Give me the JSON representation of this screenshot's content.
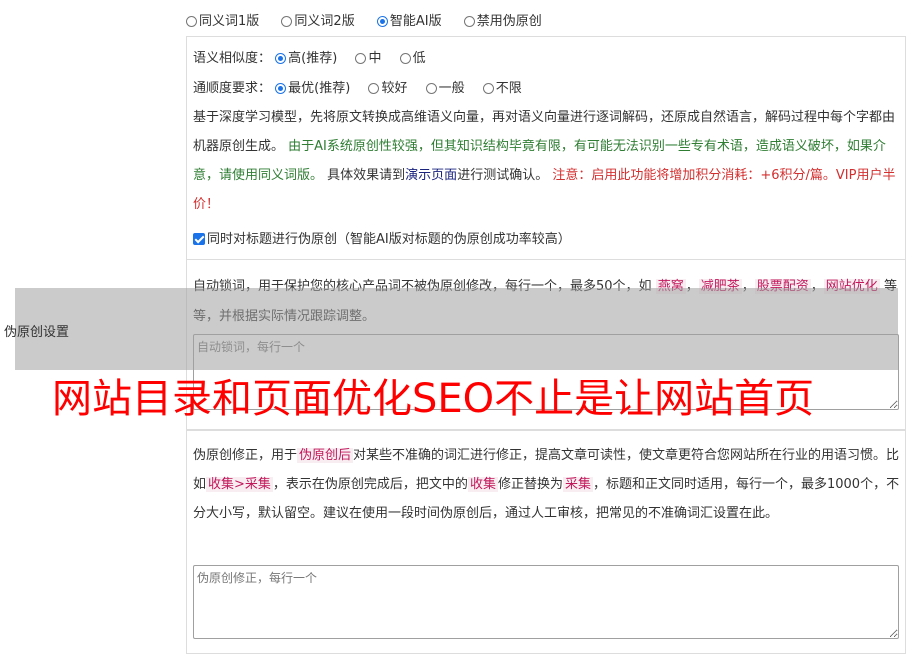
{
  "modes": [
    {
      "label": "同义词1版",
      "selected": false
    },
    {
      "label": "同义词2版",
      "selected": false
    },
    {
      "label": "智能AI版",
      "selected": true
    },
    {
      "label": "禁用伪原创",
      "selected": false
    }
  ],
  "similarity": {
    "label": "语义相似度：",
    "options": [
      "高(推荐)",
      "中",
      "低"
    ]
  },
  "fluency": {
    "label": "通顺度要求：",
    "options": [
      "最优(推荐)",
      "较好",
      "一般",
      "不限"
    ]
  },
  "ai_desc": {
    "part1": "基于深度学习模型，先将原文转换成高维语义向量，再对语义向量进行逐词解码，还原成自然语言，解码过程中每个字都由机器原创生成。",
    "part2": "由于AI系统原创性较强，但其知识结构毕竟有限，有可能无法识别一些专有术语，造成语义破坏，如果介意，请使用同义词版。",
    "part3": "具体效果请到",
    "link": "演示页面",
    "part4": "进行测试确认。",
    "part5": "注意：启用此功能将增加积分消耗：+6积分/篇。VIP用户半价！"
  },
  "title_check": {
    "label": "同时对标题进行伪原创（智能AI版对标题的伪原创成功率较高）",
    "checked": true
  },
  "lock": {
    "desc1": "自动锁词，用于保护您的核心产品词不被伪原创修改，每行一个，最多50个，如",
    "tags": [
      "燕窝",
      "减肥茶",
      "股票配资",
      "网站优化"
    ],
    "desc2": "等等，并根据实际情况跟踪调整。",
    "placeholder": "自动锁词，每行一个"
  },
  "fix": {
    "desc1": "伪原创修正，用于",
    "tag1": "伪原创后",
    "desc2": "对某些不准确的词汇进行修正，提高文章可读性，使文章更符合您网站所在行业的用语习惯。比如",
    "tag2": "收集>采集",
    "desc3": "，表示在伪原创完成后，把文中的",
    "tag3": "收集",
    "desc4": "修正替换为",
    "tag4": "采集",
    "desc5": "，标题和正文同时适用，每行一个，最多1000个，不分大小写，默认留空。建议在使用一段时间伪原创后，通过人工审核，把常见的不准确词汇设置在此。",
    "placeholder": "伪原创修正，每行一个"
  },
  "side_label": "伪原创设置",
  "overlay_text": "网站目录和页面优化SEO不止是让网站首页",
  "colors": {
    "accent": "#1a73e8",
    "green": "#2e7d32",
    "red": "#d32f2f",
    "tag": "#c2185b",
    "overlay": "#ff0000"
  }
}
